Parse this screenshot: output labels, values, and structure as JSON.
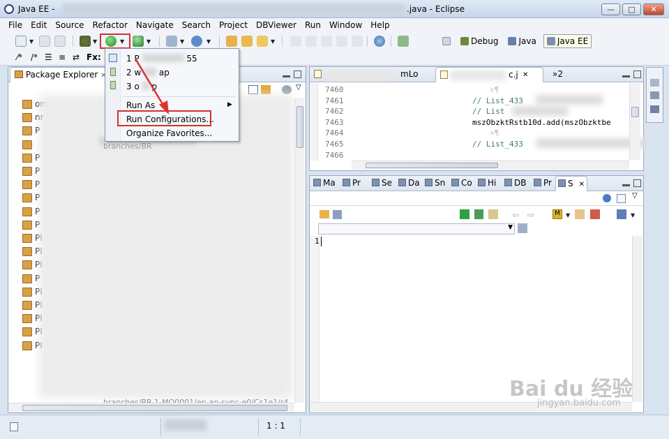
{
  "window": {
    "title_prefix": "Java EE -",
    "title_suffix": ".java - Eclipse",
    "minimize": "—",
    "maximize": "□",
    "close": "✕"
  },
  "menu": [
    "File",
    "Edit",
    "Source",
    "Refactor",
    "Navigate",
    "Search",
    "Project",
    "DBViewer",
    "Run",
    "Window",
    "Help"
  ],
  "perspectives": [
    {
      "label": "Debug",
      "active": false
    },
    {
      "label": "Java",
      "active": false
    },
    {
      "label": "Java EE",
      "active": true
    }
  ],
  "toolbar2": {
    "fx_label": "Fx:"
  },
  "package_explorer": {
    "title": "Package Explorer",
    "close": "✕",
    "visible_fragments": [
      "om",
      "nr",
      "P",
      "branches/BR",
      "P",
      "P",
      "P",
      "P",
      "P",
      "P",
      "Pl",
      "PI",
      "PI",
      "P",
      "PI",
      "PI",
      "PI",
      "PI",
      "PI"
    ],
    "bottom_fragment": "branches/BR-1-MO0001/en-ap-sync-e0/Cs1e1/r4"
  },
  "run_dropdown": {
    "history": [
      {
        "label": "1 P",
        "suffix": "55"
      },
      {
        "label": "2 w",
        "suffix": "ap"
      },
      {
        "label": "3 o",
        "suffix": "p"
      }
    ],
    "run_as": "Run As",
    "run_configurations": "Run Configurations...",
    "organize_favorites": "Organize Favorites..."
  },
  "editor": {
    "tabs": [
      {
        "label": "mLo"
      },
      {
        "label": "c.j",
        "selected": true
      },
      {
        "label": "»2"
      }
    ],
    "lines": [
      {
        "num": "7460",
        "text": "¤¶",
        "type": "dots"
      },
      {
        "num": "7461",
        "text": "// List_433",
        "type": "comment"
      },
      {
        "num": "7462",
        "text": "// List",
        "type": "comment"
      },
      {
        "num": "7463",
        "text": "mszObzktRstb10d.add(mszObzktbe",
        "type": "code"
      },
      {
        "num": "7464",
        "text": "¤¶",
        "type": "dots"
      },
      {
        "num": "7465",
        "text": "// List_433",
        "type": "comment"
      },
      {
        "num": "7466",
        "text": "",
        "type": "dots"
      }
    ]
  },
  "bottom_panel": {
    "tabs": [
      "Ma",
      "Pr",
      "Se",
      "Da",
      "Sn",
      "Co",
      "Hi",
      "DB",
      "Pr",
      "S"
    ],
    "close": "✕",
    "console_line": "1"
  },
  "status": {
    "position": "1 : 1"
  },
  "watermark": {
    "brand": "Bai du 经验",
    "url": "jingyan.baidu.com"
  }
}
